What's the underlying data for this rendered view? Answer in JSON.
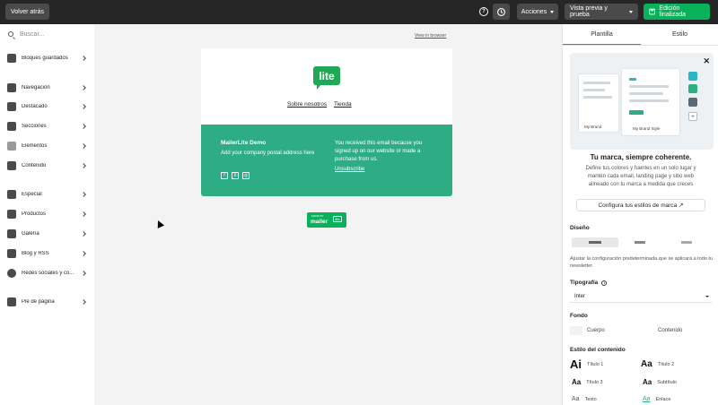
{
  "topbar": {
    "back_label": "Volver atrás",
    "actions_label": "Acciones",
    "preview_label": "Vista previa y prueba",
    "done_label": "Edición finalizada",
    "help_icon": "?"
  },
  "sidebar": {
    "search_placeholder": "Buscar...",
    "items": [
      {
        "label": "Bloques guardados",
        "icon": "bookmark-icon"
      },
      {
        "label": "Navegación",
        "icon": "navigation-icon"
      },
      {
        "label": "Destacado",
        "icon": "featured-icon"
      },
      {
        "label": "Secciones",
        "icon": "sections-icon"
      },
      {
        "label": "Elementos",
        "icon": "text-elements-icon"
      },
      {
        "label": "Contenido",
        "icon": "content-cursor-icon"
      },
      {
        "label": "Especial",
        "icon": "special-icon"
      },
      {
        "label": "Productos",
        "icon": "products-bag-icon"
      },
      {
        "label": "Galería",
        "icon": "gallery-image-icon"
      },
      {
        "label": "Blog y RSS",
        "icon": "rss-icon"
      },
      {
        "label": "Redes sociales y co...",
        "icon": "twitter-bird-icon"
      },
      {
        "label": "Pie de página",
        "icon": "footer-icon"
      }
    ]
  },
  "email": {
    "view_in_browser": "View in browser",
    "logo_text": "lite",
    "nav_links": [
      "Sobre nosotros",
      "Tienda"
    ],
    "footer": {
      "company": "MailerLite Demo",
      "address": "Add your company postal address here",
      "social": [
        "f",
        "X",
        "◎"
      ],
      "message": "You received this email because you signed up on our website or made a purchase from us.",
      "unsubscribe": "Unsubscribe"
    },
    "badge": {
      "top": "MADE BY",
      "main": "mailer",
      "lite": "lite"
    }
  },
  "panel": {
    "tabs": [
      "Plantilla",
      "Estilo"
    ],
    "brand": {
      "illustration_caption_1": "My Brand",
      "illustration_caption_2": "My Brand Style",
      "title": "Tu marca, siempre coherente.",
      "description": "Define tus colores y fuentes en un solo lugar y mantén cada email, landing page y sitio web alineado con tu marca a medida que creces",
      "button": "Configura tus estilos de marca ↗",
      "swatches": [
        "#2bb5c5",
        "#2ead84",
        "#5d6875"
      ]
    },
    "design_label": "Diseño",
    "design_desc": "Ajustar la configuración predeterminada que se aplicará a todo tu newsletter.",
    "typography_label": "Tipografía",
    "typography_font": "Inter",
    "background_label": "Fondo",
    "background_body": "Cuerpo",
    "background_content": "Contenido",
    "content_style_label": "Estilo del contenido",
    "styles": [
      {
        "aa": "Ai",
        "label": "Título 1"
      },
      {
        "aa": "Aa",
        "label": "Título 2"
      },
      {
        "aa": "Aa",
        "label": "Título 3"
      },
      {
        "aa": "Aa",
        "label": "Subtítulo"
      },
      {
        "aa": "Aa",
        "label": "Texto"
      },
      {
        "aa": "Aa",
        "label": "Enlace"
      }
    ]
  }
}
